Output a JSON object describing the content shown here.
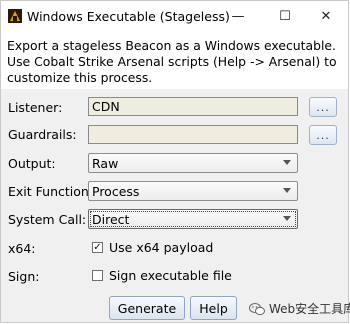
{
  "window": {
    "title": "Windows Executable (Stageless)",
    "minimize_glyph": "—",
    "maximize_glyph": "☐",
    "close_glyph": "✕"
  },
  "description": "Export a stageless Beacon as a Windows executable. Use Cobalt Strike Arsenal scripts (Help -> Arsenal) to customize this process.",
  "form": {
    "listener": {
      "label": "Listener:",
      "value": "CDN",
      "browse_label": "..."
    },
    "guardrails": {
      "label": "Guardrails:",
      "value": "",
      "browse_label": "..."
    },
    "output": {
      "label": "Output:",
      "selected": "Raw"
    },
    "exit_function": {
      "label": "Exit Function:",
      "selected": "Process"
    },
    "system_call": {
      "label": "System Call:",
      "selected": "Direct"
    },
    "x64": {
      "label": "x64:",
      "checkbox_label": "Use x64 payload",
      "checked": true,
      "check_glyph": "✓"
    },
    "sign": {
      "label": "Sign:",
      "checkbox_label": "Sign executable file",
      "checked": false,
      "check_glyph": ""
    }
  },
  "buttons": {
    "generate": "Generate",
    "help": "Help"
  },
  "watermark": {
    "text": "Web安全工具库"
  },
  "colors": {
    "field_bg": "#efeddf",
    "window_bg": "#f0f0f0",
    "button_border": "#8fa6c3"
  }
}
